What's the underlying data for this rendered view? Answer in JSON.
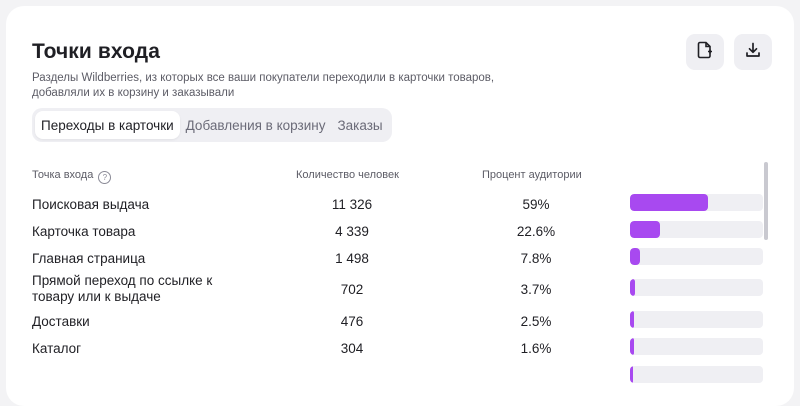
{
  "header": {
    "title": "Точки входа",
    "subtitle": "Разделы Wildberries, из которых все ваши покупатели переходили в карточки товаров, добавляли их в корзину и заказывали",
    "actions": [
      "export-file-icon",
      "download-icon"
    ]
  },
  "tabs": [
    {
      "label": "Переходы в карточки",
      "active": true
    },
    {
      "label": "Добавления в корзину",
      "active": false
    },
    {
      "label": "Заказы",
      "active": false
    }
  ],
  "table": {
    "columns": {
      "entry_point": "Точка входа",
      "count": "Количество человек",
      "percent": "Процент аудитории"
    },
    "rows": [
      {
        "name": "Поисковая выдача",
        "count": "11 326",
        "percent": "59%",
        "share": 0.59
      },
      {
        "name": "Карточка товара",
        "count": "4 339",
        "percent": "22.6%",
        "share": 0.226
      },
      {
        "name": "Главная страница",
        "count": "1 498",
        "percent": "7.8%",
        "share": 0.078
      },
      {
        "name": "Прямой переход по ссылке к товару или к выдаче",
        "count": "702",
        "percent": "3.7%",
        "share": 0.037
      },
      {
        "name": "Доставки",
        "count": "476",
        "percent": "2.5%",
        "share": 0.025
      },
      {
        "name": "Каталог",
        "count": "304",
        "percent": "1.6%",
        "share": 0.016
      }
    ]
  },
  "colors": {
    "accent": "#a849f0",
    "track": "#efeff3",
    "background": "#ffffff"
  }
}
